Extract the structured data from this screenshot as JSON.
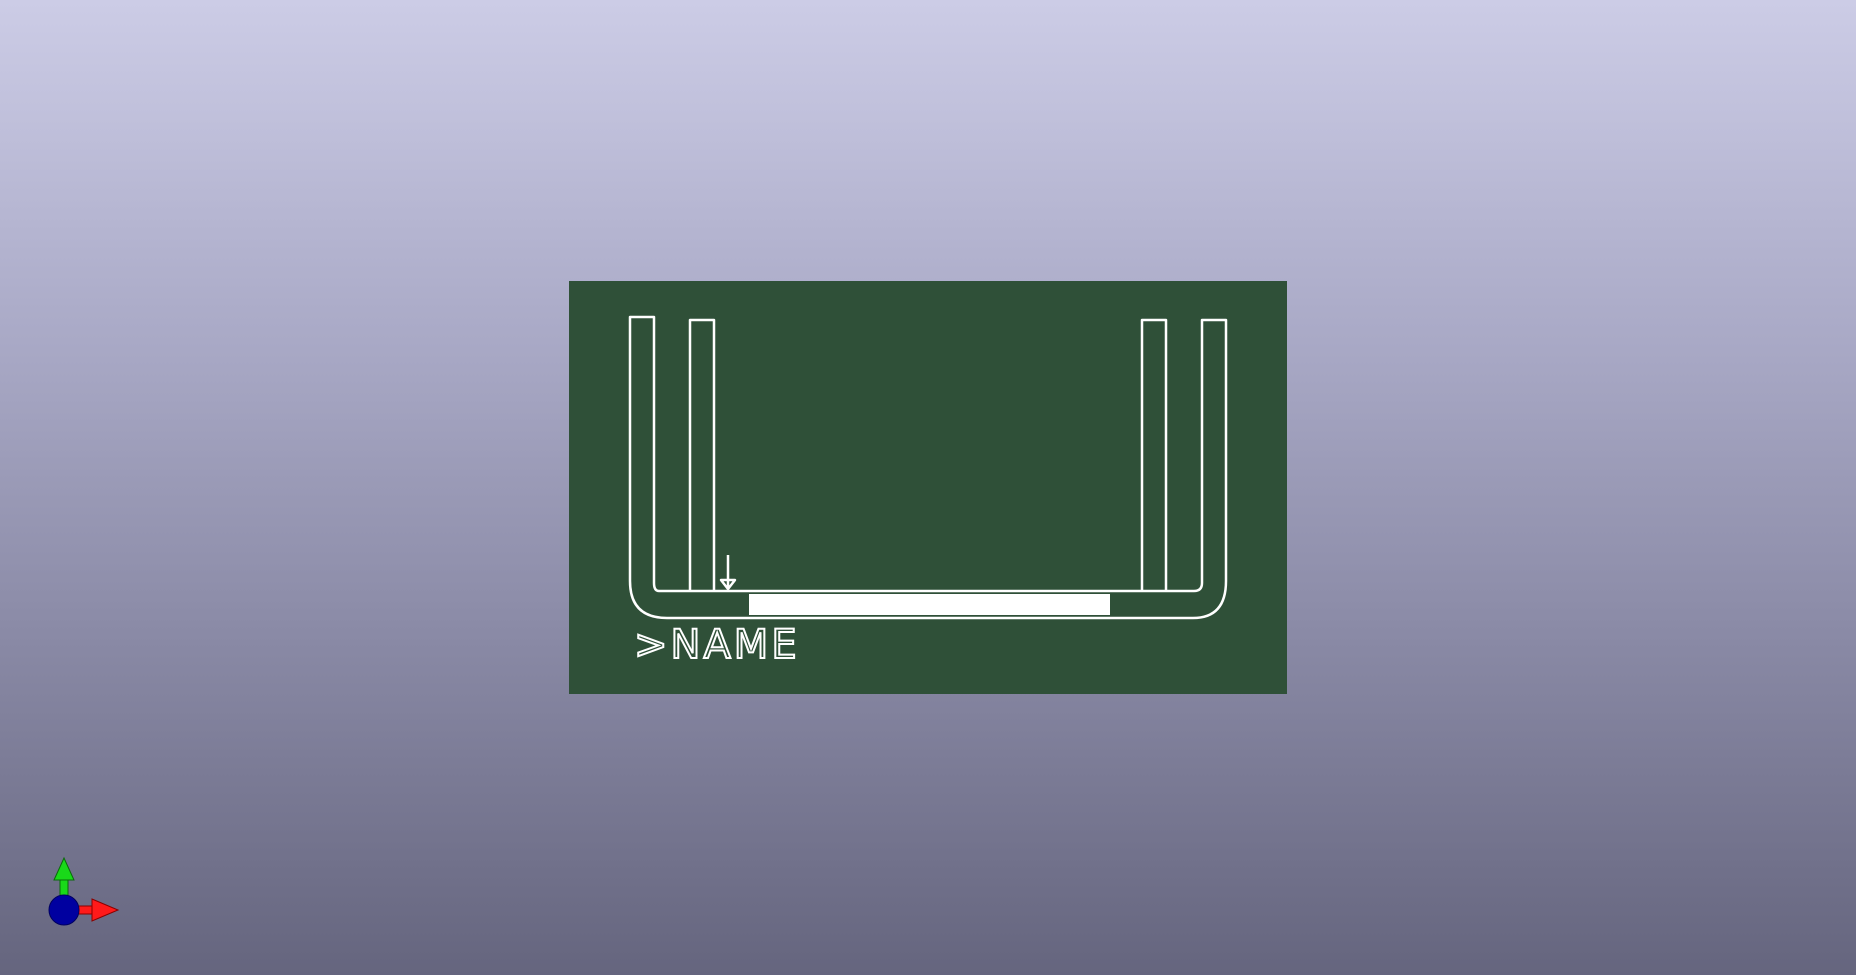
{
  "viewer": {
    "background_top_color": "#cccce6",
    "background_bottom_color": "#65657e"
  },
  "board": {
    "board_color": "#2f5038",
    "silkscreen_color": "#ffffff",
    "reference_label": ">NAME"
  },
  "axes": {
    "x_color": "#ff1a1a",
    "y_color": "#19d919",
    "z_color": "#0000a0"
  }
}
